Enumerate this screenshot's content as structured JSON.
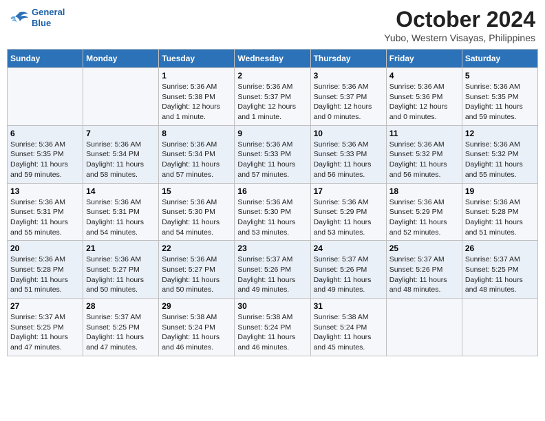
{
  "header": {
    "logo_line1": "General",
    "logo_line2": "Blue",
    "month": "October 2024",
    "location": "Yubo, Western Visayas, Philippines"
  },
  "weekdays": [
    "Sunday",
    "Monday",
    "Tuesday",
    "Wednesday",
    "Thursday",
    "Friday",
    "Saturday"
  ],
  "weeks": [
    [
      {
        "day": "",
        "info": ""
      },
      {
        "day": "",
        "info": ""
      },
      {
        "day": "1",
        "info": "Sunrise: 5:36 AM\nSunset: 5:38 PM\nDaylight: 12 hours\nand 1 minute."
      },
      {
        "day": "2",
        "info": "Sunrise: 5:36 AM\nSunset: 5:37 PM\nDaylight: 12 hours\nand 1 minute."
      },
      {
        "day": "3",
        "info": "Sunrise: 5:36 AM\nSunset: 5:37 PM\nDaylight: 12 hours\nand 0 minutes."
      },
      {
        "day": "4",
        "info": "Sunrise: 5:36 AM\nSunset: 5:36 PM\nDaylight: 12 hours\nand 0 minutes."
      },
      {
        "day": "5",
        "info": "Sunrise: 5:36 AM\nSunset: 5:35 PM\nDaylight: 11 hours\nand 59 minutes."
      }
    ],
    [
      {
        "day": "6",
        "info": "Sunrise: 5:36 AM\nSunset: 5:35 PM\nDaylight: 11 hours\nand 59 minutes."
      },
      {
        "day": "7",
        "info": "Sunrise: 5:36 AM\nSunset: 5:34 PM\nDaylight: 11 hours\nand 58 minutes."
      },
      {
        "day": "8",
        "info": "Sunrise: 5:36 AM\nSunset: 5:34 PM\nDaylight: 11 hours\nand 57 minutes."
      },
      {
        "day": "9",
        "info": "Sunrise: 5:36 AM\nSunset: 5:33 PM\nDaylight: 11 hours\nand 57 minutes."
      },
      {
        "day": "10",
        "info": "Sunrise: 5:36 AM\nSunset: 5:33 PM\nDaylight: 11 hours\nand 56 minutes."
      },
      {
        "day": "11",
        "info": "Sunrise: 5:36 AM\nSunset: 5:32 PM\nDaylight: 11 hours\nand 56 minutes."
      },
      {
        "day": "12",
        "info": "Sunrise: 5:36 AM\nSunset: 5:32 PM\nDaylight: 11 hours\nand 55 minutes."
      }
    ],
    [
      {
        "day": "13",
        "info": "Sunrise: 5:36 AM\nSunset: 5:31 PM\nDaylight: 11 hours\nand 55 minutes."
      },
      {
        "day": "14",
        "info": "Sunrise: 5:36 AM\nSunset: 5:31 PM\nDaylight: 11 hours\nand 54 minutes."
      },
      {
        "day": "15",
        "info": "Sunrise: 5:36 AM\nSunset: 5:30 PM\nDaylight: 11 hours\nand 54 minutes."
      },
      {
        "day": "16",
        "info": "Sunrise: 5:36 AM\nSunset: 5:30 PM\nDaylight: 11 hours\nand 53 minutes."
      },
      {
        "day": "17",
        "info": "Sunrise: 5:36 AM\nSunset: 5:29 PM\nDaylight: 11 hours\nand 53 minutes."
      },
      {
        "day": "18",
        "info": "Sunrise: 5:36 AM\nSunset: 5:29 PM\nDaylight: 11 hours\nand 52 minutes."
      },
      {
        "day": "19",
        "info": "Sunrise: 5:36 AM\nSunset: 5:28 PM\nDaylight: 11 hours\nand 51 minutes."
      }
    ],
    [
      {
        "day": "20",
        "info": "Sunrise: 5:36 AM\nSunset: 5:28 PM\nDaylight: 11 hours\nand 51 minutes."
      },
      {
        "day": "21",
        "info": "Sunrise: 5:36 AM\nSunset: 5:27 PM\nDaylight: 11 hours\nand 50 minutes."
      },
      {
        "day": "22",
        "info": "Sunrise: 5:36 AM\nSunset: 5:27 PM\nDaylight: 11 hours\nand 50 minutes."
      },
      {
        "day": "23",
        "info": "Sunrise: 5:37 AM\nSunset: 5:26 PM\nDaylight: 11 hours\nand 49 minutes."
      },
      {
        "day": "24",
        "info": "Sunrise: 5:37 AM\nSunset: 5:26 PM\nDaylight: 11 hours\nand 49 minutes."
      },
      {
        "day": "25",
        "info": "Sunrise: 5:37 AM\nSunset: 5:26 PM\nDaylight: 11 hours\nand 48 minutes."
      },
      {
        "day": "26",
        "info": "Sunrise: 5:37 AM\nSunset: 5:25 PM\nDaylight: 11 hours\nand 48 minutes."
      }
    ],
    [
      {
        "day": "27",
        "info": "Sunrise: 5:37 AM\nSunset: 5:25 PM\nDaylight: 11 hours\nand 47 minutes."
      },
      {
        "day": "28",
        "info": "Sunrise: 5:37 AM\nSunset: 5:25 PM\nDaylight: 11 hours\nand 47 minutes."
      },
      {
        "day": "29",
        "info": "Sunrise: 5:38 AM\nSunset: 5:24 PM\nDaylight: 11 hours\nand 46 minutes."
      },
      {
        "day": "30",
        "info": "Sunrise: 5:38 AM\nSunset: 5:24 PM\nDaylight: 11 hours\nand 46 minutes."
      },
      {
        "day": "31",
        "info": "Sunrise: 5:38 AM\nSunset: 5:24 PM\nDaylight: 11 hours\nand 45 minutes."
      },
      {
        "day": "",
        "info": ""
      },
      {
        "day": "",
        "info": ""
      }
    ]
  ]
}
